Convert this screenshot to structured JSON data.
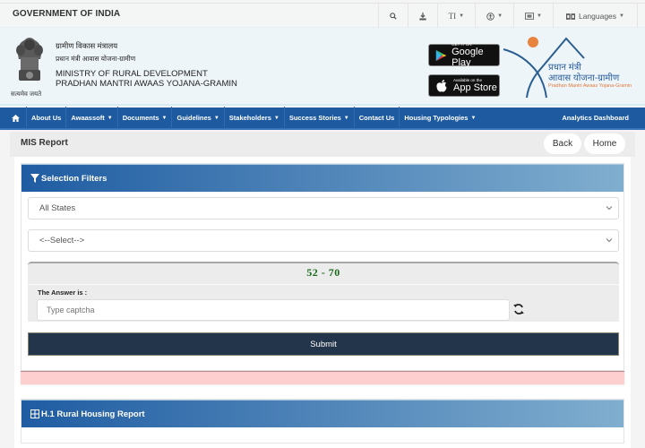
{
  "topbar": {
    "government_label": "GOVERNMENT OF INDIA",
    "tools": [
      {
        "icon": "search-icon",
        "glyph": "🔍︎"
      },
      {
        "icon": "download-icon",
        "glyph": "⤓"
      },
      {
        "icon": "text-size-icon",
        "glyph": "TI"
      },
      {
        "icon": "accessibility-icon",
        "glyph": "⊛"
      },
      {
        "icon": "contrast-icon",
        "glyph": "▥"
      }
    ],
    "languages_label": "Languages"
  },
  "header": {
    "emblem_caption": "सत्यमेव जयते",
    "hindi_ministry": "ग्रामीण विकास मंत्रालय",
    "hindi_scheme": "प्रधान मंत्री आवास योजना-ग्रामीण",
    "ministry": "MINISTRY OF RURAL DEVELOPMENT",
    "scheme": "PRADHAN MANTRI AWAAS YOJANA-GRAMIN",
    "google_play": {
      "small": "GET IT ON",
      "big": "Google Play"
    },
    "app_store": {
      "small": "Available on the",
      "big": "App Store"
    },
    "pmay_logo": {
      "hindi_line1": "प्रधान मंत्री",
      "hindi_line2": "आवास योजना-ग्रामीण",
      "english": "Pradhan Mantri Awaas Yojana-Gramin",
      "accent_orange": "#e8843e",
      "accent_blue": "#2a5ea0"
    }
  },
  "navbar": {
    "items": [
      {
        "label": "About Us",
        "dropdown": false
      },
      {
        "label": "Awaassoft",
        "dropdown": true
      },
      {
        "label": "Documents",
        "dropdown": true
      },
      {
        "label": "Guidelines",
        "dropdown": true
      },
      {
        "label": "Stakeholders",
        "dropdown": true
      },
      {
        "label": "Success Stories",
        "dropdown": true
      },
      {
        "label": "Contact Us",
        "dropdown": false
      },
      {
        "label": "Housing Typologies",
        "dropdown": true
      }
    ],
    "right_link": "Analytics Dashboard",
    "color": "#1e5aa0"
  },
  "page": {
    "title": "MIS Report",
    "back_label": "Back",
    "home_label": "Home"
  },
  "filters": {
    "title": "Selection Filters",
    "state_select": "All States",
    "second_select": "<--Select-->",
    "captcha": {
      "code": "52 - 70",
      "answer_label": "The Answer is :",
      "placeholder": "Type captcha"
    },
    "submit_label": "Submit"
  },
  "report": {
    "title": "H.1 Rural Housing Report"
  }
}
